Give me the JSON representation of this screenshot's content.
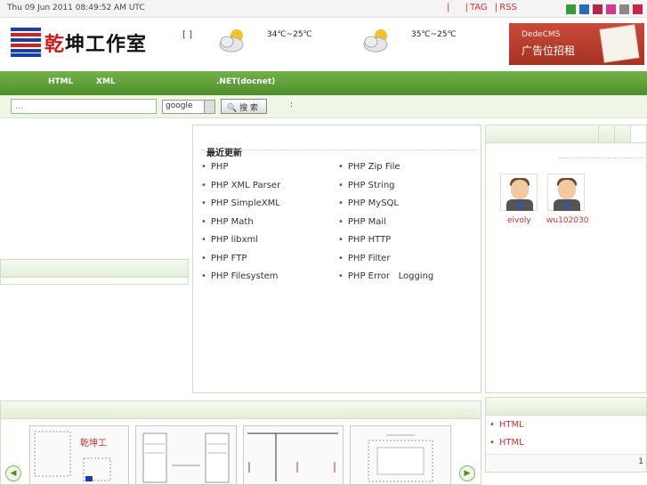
{
  "topbar": {
    "datetime": "Thu 09 Jun 2011 08:49:52 AM UTC",
    "sep1": "|",
    "sep2": "|",
    "tag_link": "TAG",
    "sep3": "|",
    "rss_link": "RSS",
    "swatches": [
      "#3a9a3a",
      "#2a6bb5",
      "#b5224a",
      "#d23a8a",
      "#8a8a8a",
      "#c8254a"
    ]
  },
  "logo": {
    "first_char": "乾",
    "rest": "坤工作室"
  },
  "weather": {
    "bracket": "[ ]",
    "today_temp": "34℃~25℃",
    "tomorrow_temp": "35℃~25℃",
    "icon": "cloud-sun-icon"
  },
  "ad": {
    "brand": "DedeCMS",
    "text": "广告位招租"
  },
  "nav": {
    "items": [
      "HTML",
      "XML",
      ".NET(docnet)"
    ]
  },
  "search": {
    "placeholder": "...",
    "engine": "google",
    "button_label": "搜 索",
    "icon": "magnifier-icon",
    "colon": ":"
  },
  "recent": {
    "title": "最近更新",
    "left": [
      "PHP",
      "PHP XML Parser",
      "PHP SimpleXML",
      "PHP Math",
      "PHP libxml",
      "PHP FTP",
      "PHP Filesystem"
    ],
    "right": [
      "PHP Zip File",
      "PHP String",
      "PHP MySQL",
      "PHP Mail",
      "PHP HTTP",
      "PHP Filter",
      "PHP Error   Logging"
    ]
  },
  "members": [
    {
      "name": "eivoly"
    },
    {
      "name": "wu102030"
    }
  ],
  "links_box": {
    "items": [
      "HTML",
      "HTML"
    ],
    "page": "1"
  },
  "carousel": {
    "prev_icon": "arrow-left-icon",
    "prev": "◀",
    "next_icon": "arrow-right-icon",
    "next": "▶"
  },
  "colors": {
    "nav_green": "#4e8f2a",
    "link_red": "#cc3333",
    "ad_red": "#b23a2a"
  }
}
